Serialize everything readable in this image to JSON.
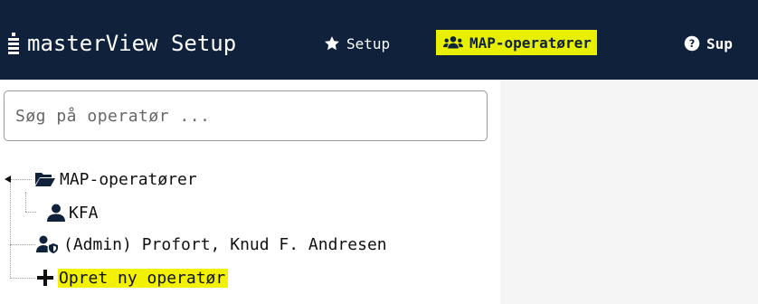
{
  "header": {
    "title": "masterView Setup",
    "nav": [
      {
        "label": "Setup",
        "icon": "star-icon"
      },
      {
        "label": "MAP-operatører",
        "icon": "users-icon",
        "active": true
      },
      {
        "label": "Sup",
        "icon": "question-circle-icon"
      }
    ]
  },
  "search": {
    "placeholder": "Søg på operatør ..."
  },
  "tree": {
    "root": {
      "label": "MAP-operatører",
      "icon": "folder-open-icon"
    },
    "child": {
      "label": "KFA",
      "icon": "user-icon"
    },
    "admin": {
      "label": "(Admin) Profort, Knud F. Andresen",
      "icon": "user-shield-icon"
    },
    "create": {
      "label": "Opret ny operatør",
      "icon": "plus-icon"
    }
  },
  "colors": {
    "header_bg": "#10213c",
    "highlight": "#e8f000"
  }
}
